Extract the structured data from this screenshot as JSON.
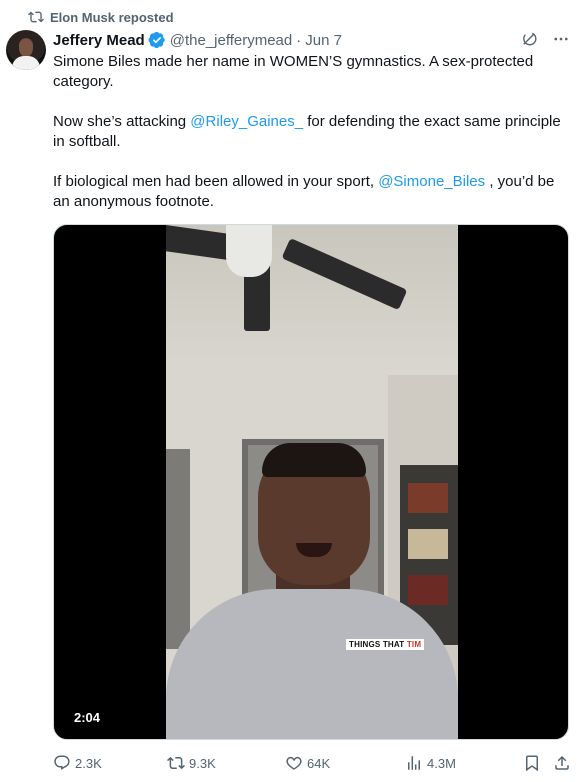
{
  "repost": {
    "label": "Elon Musk reposted",
    "icon": "repost-icon"
  },
  "author": {
    "name": "Jeffery Mead",
    "handle": "@the_jefferymead",
    "separator": "·",
    "date": "Jun 7",
    "verified_color": "#1d9bf0"
  },
  "tweet": {
    "p1": "Simone Biles made her name in WOMEN’S gymnastics. A sex-protected category.",
    "p2_before": "Now she’s attacking ",
    "p2_mention": "@Riley_Gaines_",
    "p2_after": " for defending the exact same principle in softball.",
    "p3_before": "If biological men had been allowed in your sport, ",
    "p3_mention": "@Simone_Biles",
    "p3_after": " , you’d be an anonymous footnote."
  },
  "media": {
    "duration": "2:04",
    "watermark_part1": "THINGS THAT ",
    "watermark_part2": "TIM"
  },
  "actions": {
    "replies": "2.3K",
    "reposts": "9.3K",
    "likes": "64K",
    "views": "4.3M"
  },
  "colors": {
    "accent": "#1d9bf0",
    "muted": "#536471",
    "text": "#0f1419"
  }
}
